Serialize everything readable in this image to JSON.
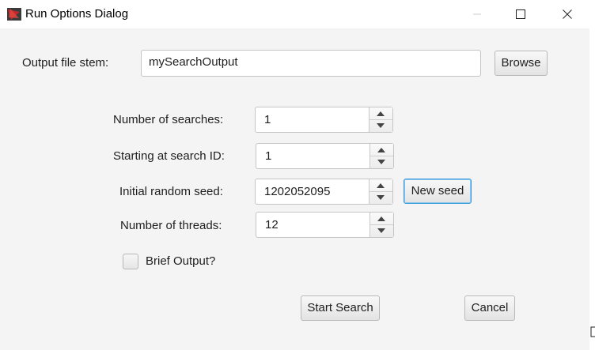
{
  "window": {
    "title": "Run Options Dialog",
    "icons": [
      "app-icon",
      "minimize-icon",
      "maximize-icon",
      "close-icon"
    ]
  },
  "output": {
    "label": "Output file stem:",
    "value": "mySearchOutput",
    "browse_label": "Browse"
  },
  "fields": {
    "num_searches": {
      "label": "Number of searches:",
      "value": "1"
    },
    "start_id": {
      "label": "Starting at search ID:",
      "value": "1"
    },
    "seed": {
      "label": "Initial random seed:",
      "value": "1202052095",
      "new_seed_label": "New seed"
    },
    "threads": {
      "label": "Number of threads:",
      "value": "12"
    }
  },
  "brief_output": {
    "label": "Brief Output?",
    "checked": false
  },
  "actions": {
    "start_label": "Start Search",
    "cancel_label": "Cancel"
  },
  "colors": {
    "focus_accent": "#3a9ad9",
    "app_icon_red": "#c0282a"
  }
}
